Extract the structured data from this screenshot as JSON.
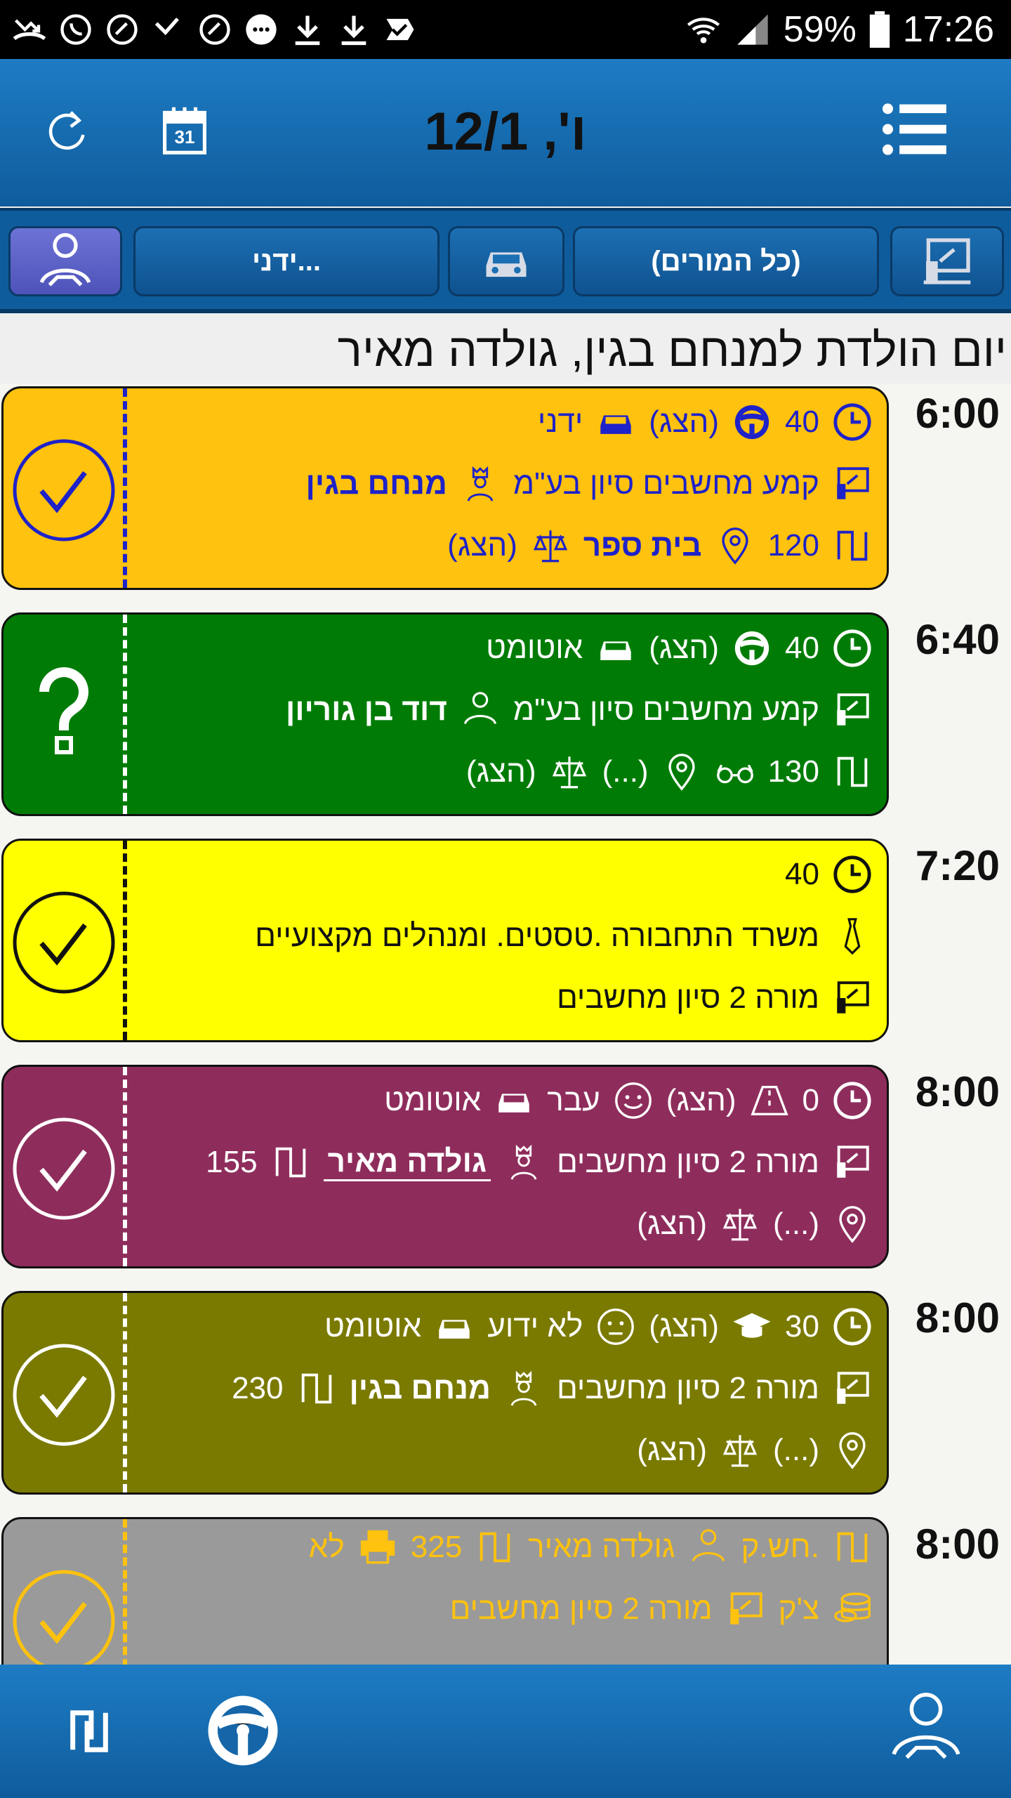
{
  "status_bar": {
    "battery": "59%",
    "time": "17:26",
    "icons_left": [
      "missed-call-icon",
      "whatsapp-icon",
      "call-icon",
      "missed-call-icon",
      "call-icon",
      "message-icon",
      "download-icon",
      "download-icon",
      "check-icon"
    ]
  },
  "header": {
    "title": "ו', 12/1",
    "calendar_day": "31",
    "icons": [
      "refresh-icon",
      "calendar-icon",
      "menu-icon"
    ]
  },
  "filters": {
    "student_filter": "ידני...",
    "teacher_filter": "(כל המורים)"
  },
  "day_title": "יום הולדת למנחם בגין, גולדה מאיר",
  "lessons": [
    {
      "time": "6:00",
      "bg": "#ffc20e",
      "fg": "#1e22c9",
      "status": "check",
      "duration": "40",
      "extra1": "(הצג)",
      "car_label": "ידני",
      "location": "קמע מחשבים סיון בע\"מ",
      "person": "מנחם בגין",
      "price": "120",
      "place": "בית ספר",
      "extra2": "(הצג)"
    },
    {
      "time": "6:40",
      "bg": "#007c06",
      "fg": "#ffffff",
      "status": "question",
      "duration": "40",
      "extra1": "(הצג)",
      "car_label": "אוטומט",
      "location": "קמע מחשבים סיון בע\"מ",
      "person": "דוד בן גוריון",
      "price": "130",
      "place": "(...)",
      "extra2": "(הצג)"
    },
    {
      "time": "7:20",
      "bg": "#ffff00",
      "fg": "#111111",
      "status": "check",
      "duration": "40",
      "description": "משרד התחבורה .טסטים. ומנהלים מקצועיים",
      "location": "מורה 2 סיון מחשבים"
    },
    {
      "time": "8:00",
      "bg": "#8e2d5c",
      "fg": "#ffffff",
      "status": "check",
      "duration": "0",
      "extra1": "(הצג)",
      "mood": "עבר",
      "car_label": "אוטומט",
      "location": "מורה 2 סיון מחשבים",
      "person": "גולדה מאיר",
      "price": "155",
      "place": "(...)",
      "extra2": "(הצג)"
    },
    {
      "time": "8:00",
      "bg": "#7a7a00",
      "fg": "#ffffff",
      "status": "check",
      "duration": "30",
      "extra1": "(הצג)",
      "mood": "לא ידוע",
      "car_label": "אוטומט",
      "location": "מורה 2 סיון מחשבים",
      "person": "מנחם בגין",
      "price": "230",
      "place": "(...)",
      "extra2": "(הצג)"
    },
    {
      "time": "8:00",
      "bg": "#9a9a9a",
      "fg": "#ffc20e",
      "status": "check",
      "invoice": "חש.ק.",
      "person": "גולדה מאיר",
      "price": "325",
      "printed": "לא",
      "payment": "צ'ק",
      "location": "מורה 2 סיון מחשבים"
    }
  ],
  "bottom_nav": {
    "icons": [
      "shekel-icon",
      "steering-wheel-icon",
      "driver-icon"
    ]
  }
}
